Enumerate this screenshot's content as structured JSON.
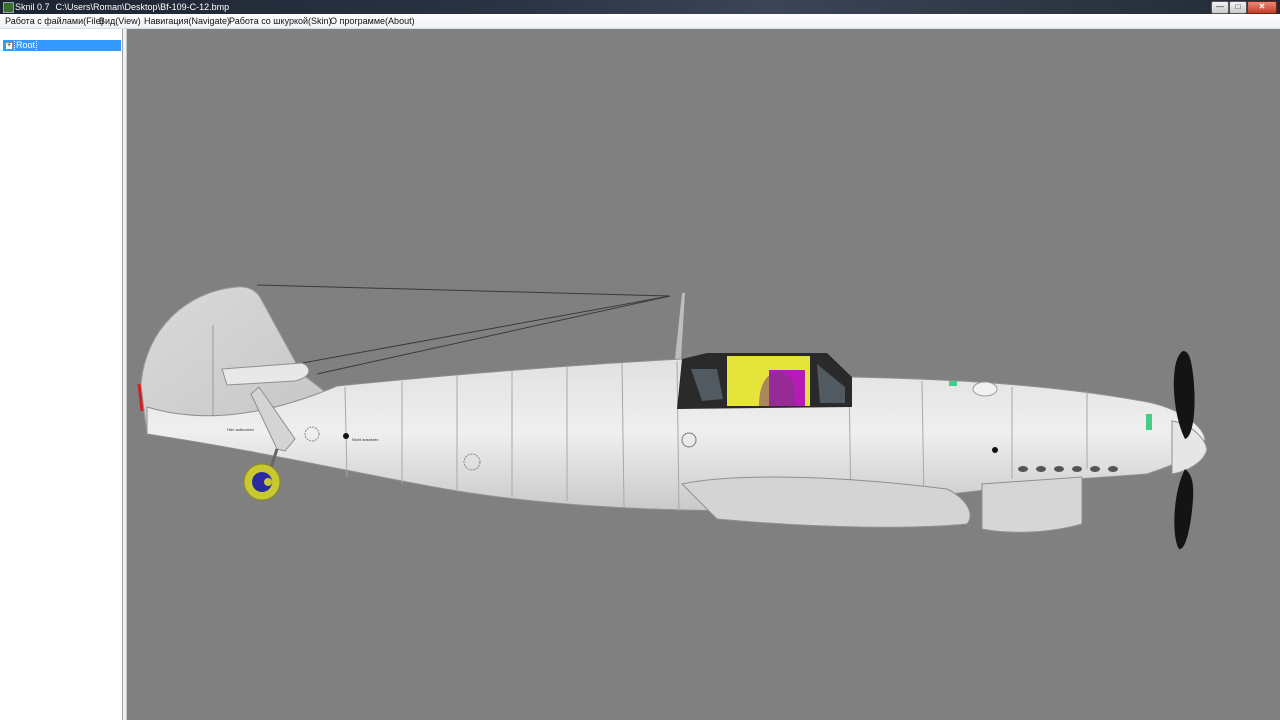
{
  "window": {
    "app_name": "Sknil 0.7",
    "file_path": "C:\\Users\\Roman\\Desktop\\Bf-109-C-12.bmp",
    "minimize_glyph": "—",
    "maximize_glyph": "□",
    "close_glyph": "✕"
  },
  "menu": [
    {
      "label": "Работа с файлами(File)"
    },
    {
      "label": "Вид(View)"
    },
    {
      "label": "Навигация(Navigate)"
    },
    {
      "label": "Работа со шкуркой(Skin)"
    },
    {
      "label": "О программе(About)"
    }
  ],
  "tree": {
    "root_label": "Root",
    "expand_glyph": "+"
  },
  "viewport": {
    "background_color": "#808080",
    "model": "Bf-109 aircraft model",
    "markings": [
      "Nicht ansetzen",
      "Hier aufbocken"
    ]
  },
  "colors": {
    "selection": "#3399ff",
    "airframe": "#e3e3e3",
    "canopy_yellow": "#e4e43a",
    "canopy_magenta": "#b81ab8",
    "propeller": "#141414",
    "tail_wheel_ring": "#c8c832",
    "tail_wheel_hub": "#2a2aa0"
  }
}
